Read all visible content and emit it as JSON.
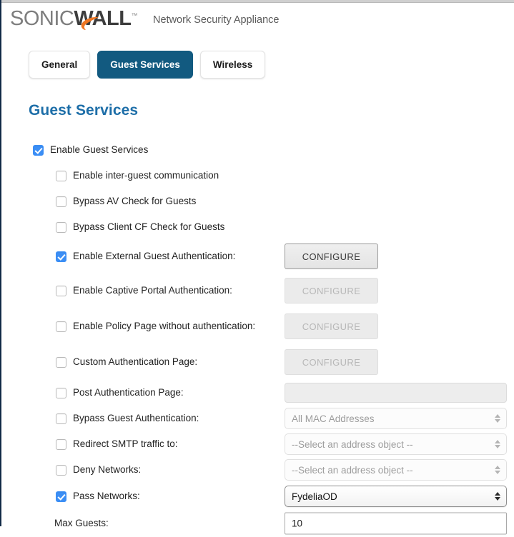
{
  "brand": {
    "logo_part1": "SONIC",
    "logo_part2": "WALL",
    "trademark": "™",
    "product": "Network Security Appliance",
    "accent_color": "#ef7622",
    "tab_active_color": "#125a80",
    "heading_color": "#1d6ea8",
    "checkbox_color": "#3b8ef5"
  },
  "tabs": [
    {
      "label": "General",
      "active": false
    },
    {
      "label": "Guest Services",
      "active": true
    },
    {
      "label": "Wireless",
      "active": false
    }
  ],
  "page_title": "Guest Services",
  "rows": [
    {
      "label": "Enable Guest Services",
      "checked": true,
      "level": 0,
      "control": "none"
    },
    {
      "label": "Enable inter-guest communication",
      "checked": false,
      "level": 1,
      "control": "none"
    },
    {
      "label": "Bypass AV Check for Guests",
      "checked": false,
      "level": 1,
      "control": "none"
    },
    {
      "label": "Bypass Client CF Check for Guests",
      "checked": false,
      "level": 1,
      "control": "none"
    },
    {
      "label": "Enable External Guest Authentication:",
      "checked": true,
      "level": 1,
      "control": "button",
      "button_label": "CONFIGURE",
      "enabled": true
    },
    {
      "label": "Enable Captive Portal Authentication:",
      "checked": false,
      "level": 1,
      "control": "button",
      "button_label": "CONFIGURE",
      "enabled": false
    },
    {
      "label": "Enable Policy Page without authentication:",
      "checked": false,
      "level": 1,
      "control": "button",
      "button_label": "CONFIGURE",
      "enabled": false
    },
    {
      "label": "Custom Authentication Page:",
      "checked": false,
      "level": 1,
      "control": "button",
      "button_label": "CONFIGURE",
      "enabled": false
    },
    {
      "label": "Post Authentication Page:",
      "checked": false,
      "level": 1,
      "control": "text",
      "value": "",
      "enabled": false
    },
    {
      "label": "Bypass Guest Authentication:",
      "checked": false,
      "level": 1,
      "control": "select",
      "value": "All MAC Addresses",
      "enabled": false
    },
    {
      "label": "Redirect SMTP traffic to:",
      "checked": false,
      "level": 1,
      "control": "select",
      "value": "--Select an address object --",
      "enabled": false
    },
    {
      "label": "Deny Networks:",
      "checked": false,
      "level": 1,
      "control": "select",
      "value": "--Select an address object --",
      "enabled": false
    },
    {
      "label": "Pass Networks:",
      "checked": true,
      "level": 1,
      "control": "select",
      "value": "FydeliaOD",
      "enabled": true
    },
    {
      "label": "Max Guests:",
      "checked": null,
      "level": 0,
      "control": "text",
      "value": "10",
      "enabled": true
    }
  ]
}
